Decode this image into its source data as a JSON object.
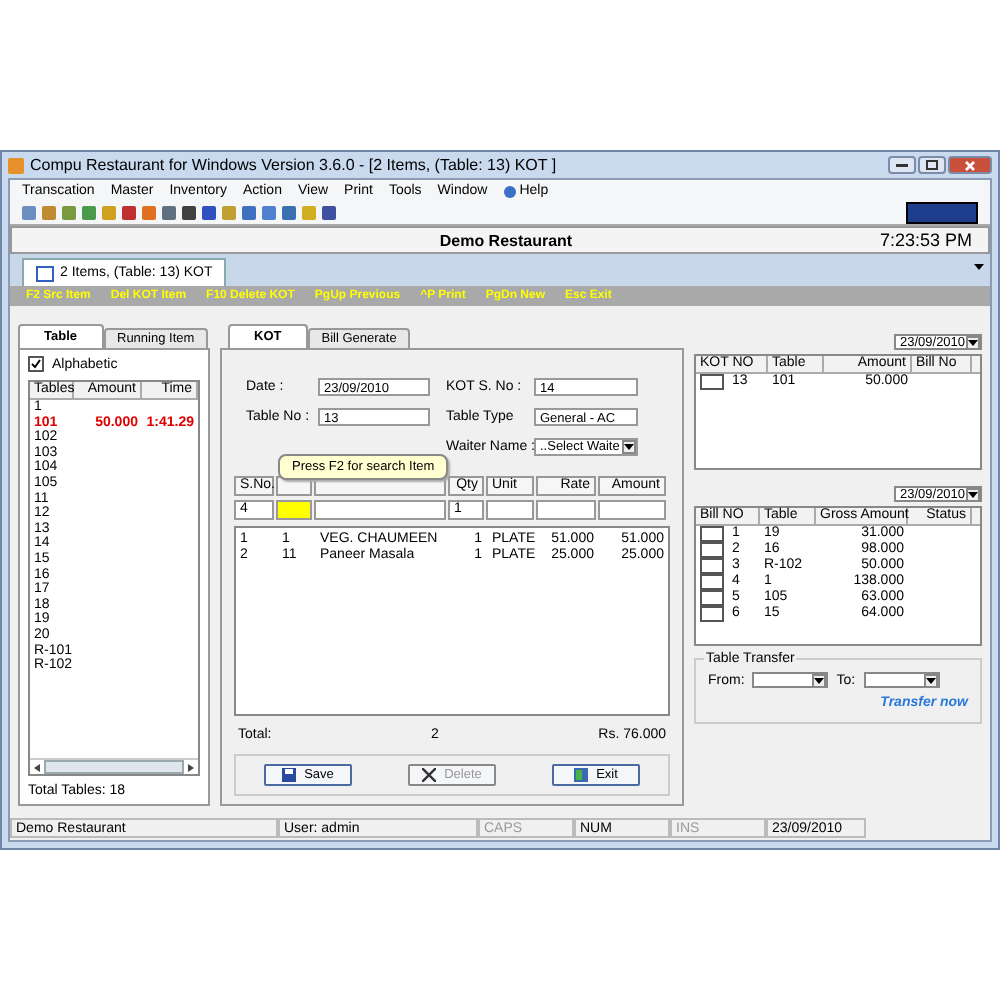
{
  "window": {
    "title": "Compu Restaurant for Windows Version 3.6.0 - [2 Items, (Table: 13) KOT ]"
  },
  "menu": [
    "Transcation",
    "Master",
    "Inventory",
    "Action",
    "View",
    "Print",
    "Tools",
    "Window",
    "Help"
  ],
  "header": {
    "title": "Demo Restaurant",
    "time": "7:23:53 PM"
  },
  "doc_tab": {
    "label": "2 Items, (Table: 13) KOT"
  },
  "shortcuts": [
    "F2 Src Item",
    "Del KOT Item",
    "F10 Delete KOT",
    "PgUp Previous",
    "^P Print",
    "PgDn New",
    "Esc Exit"
  ],
  "left_panel": {
    "tabs": [
      {
        "label": "Table",
        "selected": true
      },
      {
        "label": "Running Item",
        "selected": false
      }
    ],
    "alphabetic": {
      "label": "Alphabetic",
      "checked": true
    },
    "columns": [
      "Tables",
      "Amount",
      "Time"
    ],
    "rows": [
      {
        "table": "1",
        "active": false
      },
      {
        "table": "101",
        "amount": "50.000",
        "time": "1:41.29",
        "active": true
      },
      {
        "table": "102",
        "active": false
      },
      {
        "table": "103",
        "active": false
      },
      {
        "table": "104",
        "active": false
      },
      {
        "table": "105",
        "active": false
      },
      {
        "table": "11",
        "active": false
      },
      {
        "table": "12",
        "active": false
      },
      {
        "table": "13",
        "active": false
      },
      {
        "table": "14",
        "active": false
      },
      {
        "table": "15",
        "active": false
      },
      {
        "table": "16",
        "active": false
      },
      {
        "table": "17",
        "active": false
      },
      {
        "table": "18",
        "active": false
      },
      {
        "table": "19",
        "active": false
      },
      {
        "table": "20",
        "active": false
      },
      {
        "table": "R-101",
        "active": false
      },
      {
        "table": "R-102",
        "active": false
      }
    ],
    "footer": "Total Tables: 18"
  },
  "kot_panel": {
    "tabs": [
      {
        "label": "KOT",
        "selected": true
      },
      {
        "label": "Bill Generate",
        "selected": false
      }
    ],
    "date": {
      "label": "Date :",
      "value": "23/09/2010"
    },
    "kot_no": {
      "label": "KOT S. No :",
      "value": "14"
    },
    "table_no": {
      "label": "Table No :",
      "value": "13"
    },
    "table_type": {
      "label": "Table Type",
      "value": "General - AC"
    },
    "waiter": {
      "label": "Waiter Name :",
      "value": "..Select Waite"
    },
    "columns": [
      {
        "label": "S.No."
      },
      {},
      {},
      {
        "label": "Qty"
      },
      {
        "label": "Unit"
      },
      {
        "label": "Rate"
      },
      {
        "label": "Amount"
      }
    ],
    "entry": [
      {
        "value": "4",
        "highlighted": false
      },
      {
        "highlighted": true
      },
      {
        "highlighted": false
      },
      {
        "value": "1",
        "highlighted": false
      },
      {
        "highlighted": false
      },
      {
        "highlighted": false
      },
      {
        "highlighted": false
      }
    ],
    "tooltip": "Press F2 for search Item",
    "items": [
      [
        "1",
        "1",
        "VEG. CHAUMEEN",
        "1",
        "PLATE",
        "51.000",
        "51.000"
      ],
      [
        "2",
        "11",
        "Paneer Masala",
        "1",
        "PLATE",
        "25.000",
        "25.000"
      ]
    ],
    "total_label": "Total:",
    "total_count": "2",
    "total_amount": "Rs. 76.000",
    "buttons": [
      {
        "label": "Save",
        "kind": "save",
        "disabled": false
      },
      {
        "label": "Delete",
        "kind": "delete",
        "disabled": true
      },
      {
        "label": "Exit",
        "kind": "exit",
        "disabled": false
      }
    ]
  },
  "kot_list": {
    "date": "23/09/2010",
    "columns": [
      "KOT NO",
      "Table",
      "Amount",
      "Bill No"
    ],
    "rows": [
      {
        "checked": false,
        "cells": [
          "13",
          "101",
          "50.000"
        ]
      }
    ]
  },
  "bills": {
    "date": "23/09/2010",
    "columns": [
      "Bill NO",
      "Table",
      "Gross Amount",
      "Status"
    ],
    "rows": [
      {
        "checked": false,
        "cells": [
          "1",
          "19",
          "31.000"
        ]
      },
      {
        "checked": false,
        "cells": [
          "2",
          "16",
          "98.000"
        ]
      },
      {
        "checked": false,
        "cells": [
          "3",
          "R-102",
          "50.000"
        ]
      },
      {
        "checked": false,
        "cells": [
          "4",
          "1",
          "138.000"
        ]
      },
      {
        "checked": false,
        "cells": [
          "5",
          "105",
          "63.000"
        ]
      },
      {
        "checked": false,
        "cells": [
          "6",
          "15",
          "64.000"
        ]
      }
    ]
  },
  "table_transfer": {
    "title": "Table Transfer",
    "from_label": "From:",
    "to_label": "To:",
    "link": "Transfer now"
  },
  "status_bar": [
    {
      "text": "Demo Restaurant",
      "disabled": false
    },
    {
      "text": "User: admin",
      "disabled": false
    },
    {
      "text": "CAPS",
      "disabled": true
    },
    {
      "text": "NUM",
      "disabled": false
    },
    {
      "text": "INS",
      "disabled": true
    },
    {
      "text": "23/09/2010",
      "disabled": false
    }
  ]
}
